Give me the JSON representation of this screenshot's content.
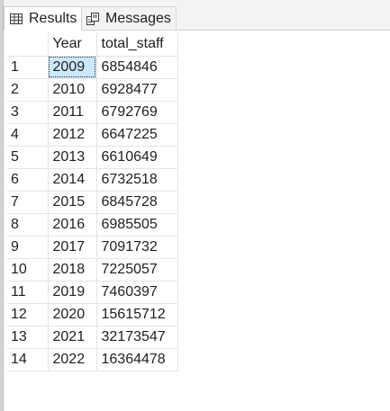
{
  "tabs": {
    "results_label": "Results",
    "messages_label": "Messages"
  },
  "icons": {
    "results": "grid-icon",
    "messages": "messages-icon"
  },
  "grid": {
    "columns": [
      "",
      "Year",
      "total_staff"
    ],
    "rows": [
      {
        "num": "1",
        "year": "2009",
        "staff": "6854846"
      },
      {
        "num": "2",
        "year": "2010",
        "staff": "6928477"
      },
      {
        "num": "3",
        "year": "2011",
        "staff": "6792769"
      },
      {
        "num": "4",
        "year": "2012",
        "staff": "6647225"
      },
      {
        "num": "5",
        "year": "2013",
        "staff": "6610649"
      },
      {
        "num": "6",
        "year": "2014",
        "staff": "6732518"
      },
      {
        "num": "7",
        "year": "2015",
        "staff": "6845728"
      },
      {
        "num": "8",
        "year": "2016",
        "staff": "6985505"
      },
      {
        "num": "9",
        "year": "2017",
        "staff": "7091732"
      },
      {
        "num": "10",
        "year": "2018",
        "staff": "7225057"
      },
      {
        "num": "11",
        "year": "2019",
        "staff": "7460397"
      },
      {
        "num": "12",
        "year": "2020",
        "staff": "15615712"
      },
      {
        "num": "13",
        "year": "2021",
        "staff": "32173547"
      },
      {
        "num": "14",
        "year": "2022",
        "staff": "16364478"
      }
    ]
  },
  "colors": {
    "selected_cell": "#cce8ff",
    "grid_line": "#e4e4e4"
  }
}
